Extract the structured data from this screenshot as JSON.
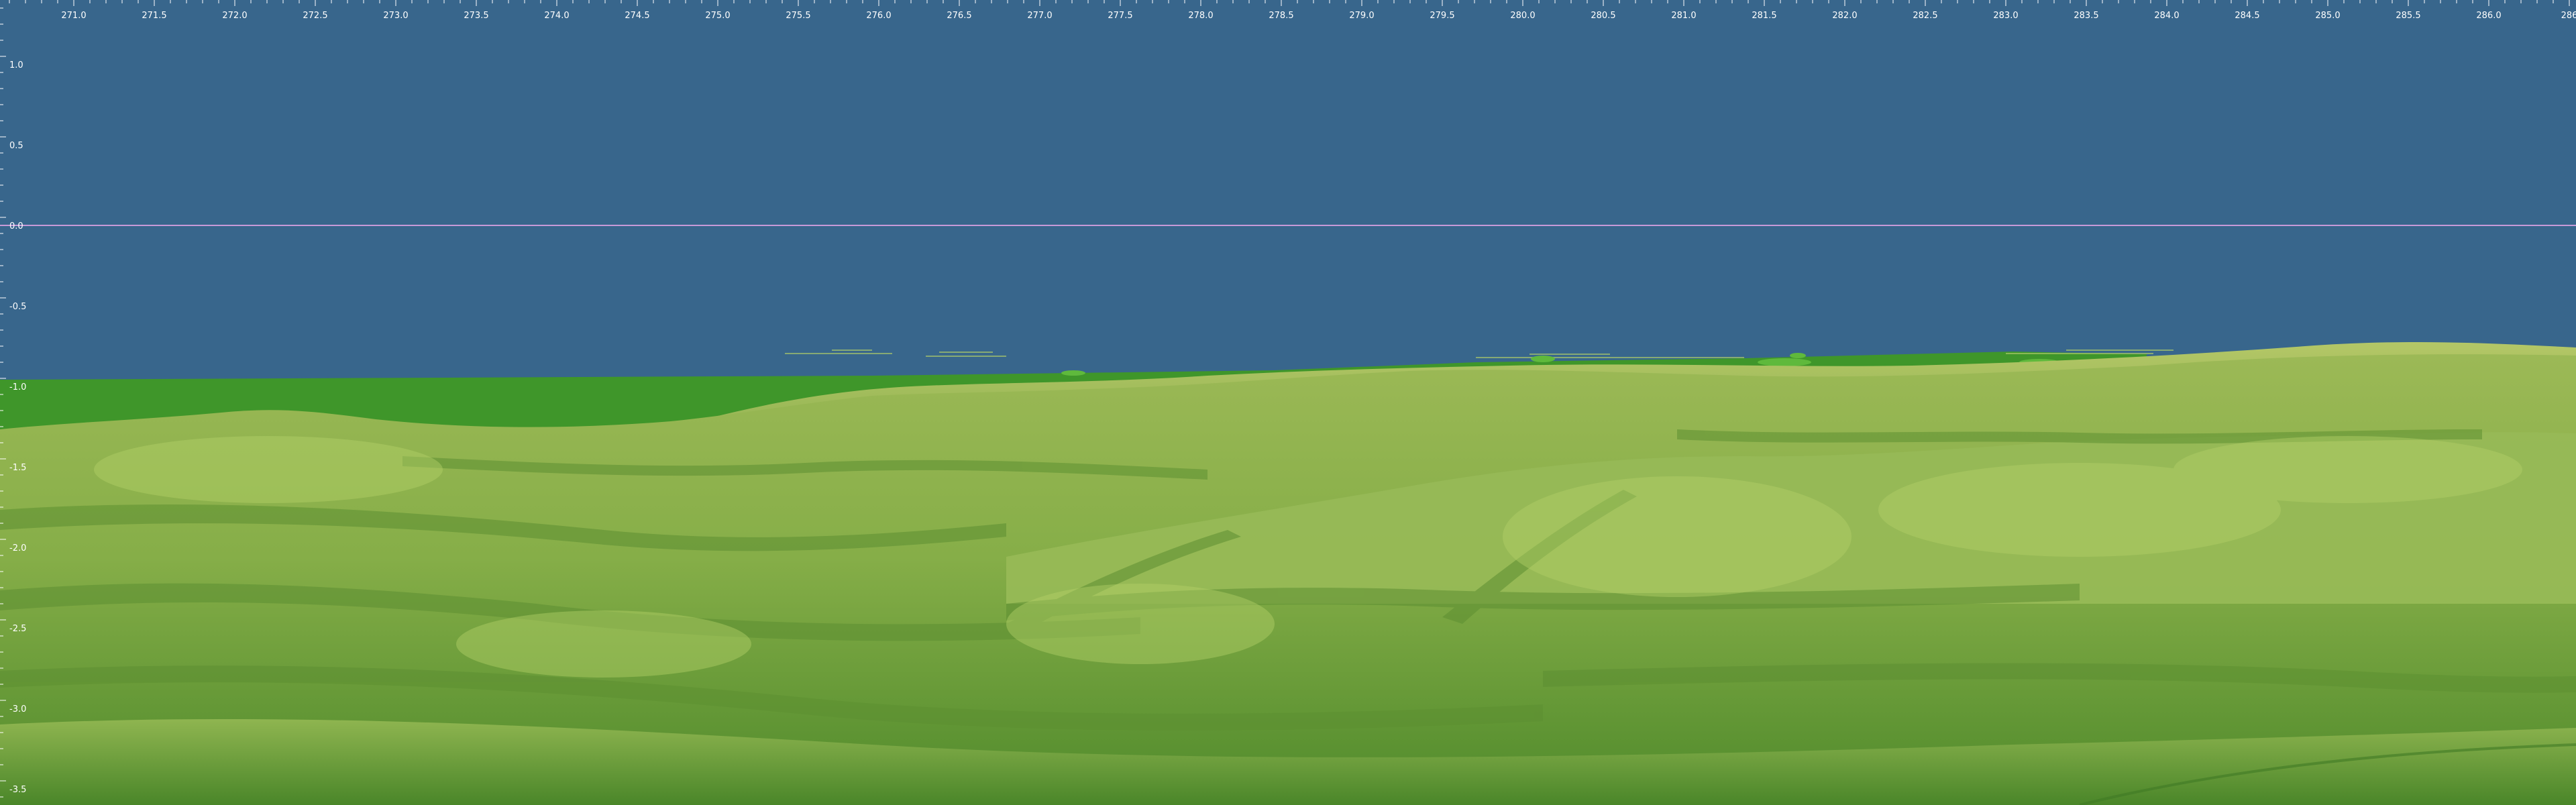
{
  "viewer": {
    "sky_color": "#38668c",
    "horizon_line_color": "#c79ad8",
    "terrain_colors": {
      "flat_green": "#3f962a",
      "ridge_light": "#a8c05a",
      "ridge_mid": "#8fb24e",
      "valley_dark": "#5d8f32",
      "foreground": "#548f2e"
    }
  },
  "top_ruler": {
    "labels": [
      "271.0",
      "271.5",
      "272.0",
      "272.5",
      "273.0",
      "273.5",
      "274.0",
      "274.5",
      "275.0",
      "275.5",
      "276.0",
      "276.5",
      "277.0",
      "277.5",
      "278.0",
      "278.5",
      "279.0",
      "279.5",
      "280.0",
      "280.5",
      "281.0",
      "281.5",
      "282.0",
      "282.5",
      "283.0",
      "283.5",
      "284.0",
      "284.5",
      "285.0",
      "285.5",
      "286.0",
      "286"
    ]
  },
  "left_ruler": {
    "labels": [
      "1.0",
      "0.5",
      "0.0",
      "-0.5",
      "-1.0",
      "-1.5",
      "-2.0",
      "-2.5",
      "-3.0",
      "-3.5"
    ]
  }
}
